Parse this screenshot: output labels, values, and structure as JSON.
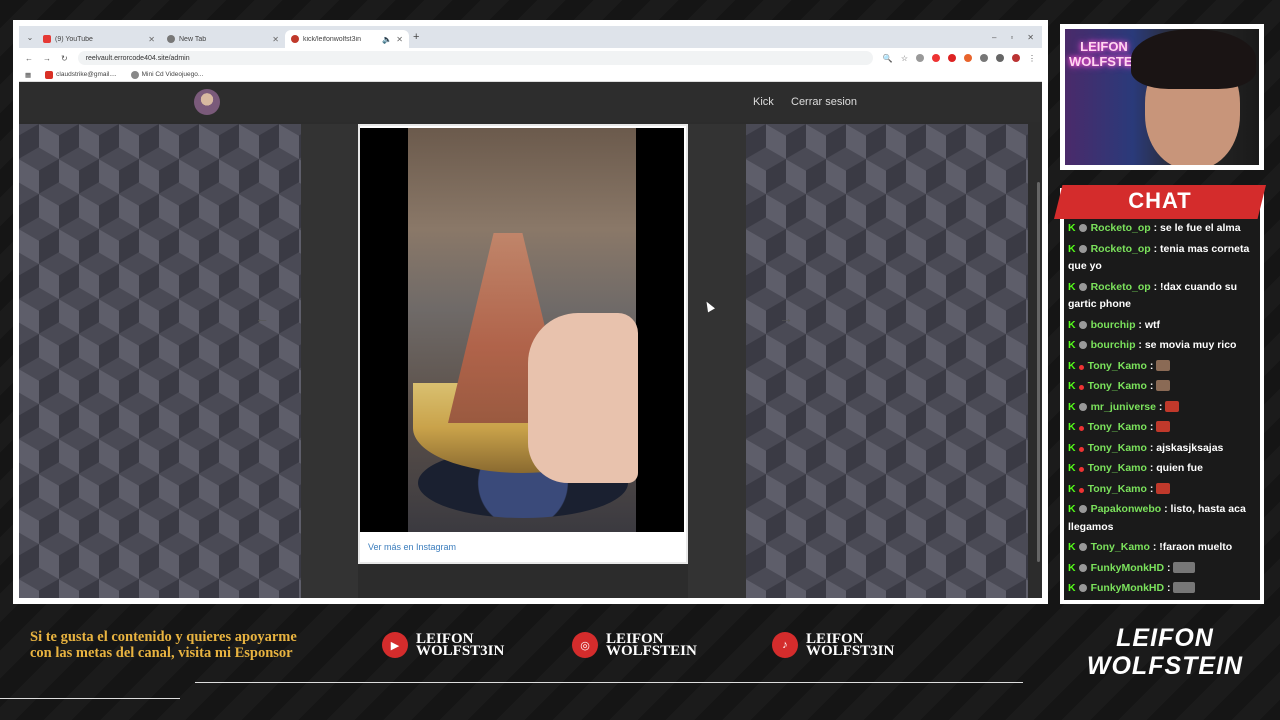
{
  "browser": {
    "tabs": [
      {
        "title": "(9) YouTube",
        "icon": "youtube-icon",
        "color": "#e53935",
        "active": false
      },
      {
        "title": "New Tab",
        "icon": "chrome-icon",
        "color": "#777777",
        "active": false
      },
      {
        "title": "kick/leifonwolfst3in",
        "icon": "kick-icon",
        "color": "#c0392b",
        "active": true
      }
    ],
    "url": "reelvault.errorcode404.site/admin",
    "bookmarks": [
      {
        "label": "claudstrike@gmail...."
      },
      {
        "label": "Mini Cd Videojuego..."
      }
    ]
  },
  "site": {
    "nav_kick": "Kick",
    "nav_logout": "Cerrar sesion",
    "instagram_link": "Ver más en Instagram"
  },
  "chat": {
    "title": "CHAT",
    "messages": [
      {
        "user": "Rocketo_op",
        "text": " : se le fue el alma"
      },
      {
        "user": "Rocketo_op",
        "text": " : tenia mas corneta que yo"
      },
      {
        "user": "Rocketo_op",
        "text": " : !dax cuando su gartic phone"
      },
      {
        "user": "bourchip",
        "text": " : wtf"
      },
      {
        "user": "bourchip",
        "text": " : se movia muy rico"
      },
      {
        "user": "Tony_Kamo",
        "text": " : ",
        "emote": "face"
      },
      {
        "user": "Tony_Kamo",
        "text": " : ",
        "emote": "face"
      },
      {
        "user": "mr_juniverse",
        "text": " : ",
        "emote": "red"
      },
      {
        "user": "Tony_Kamo",
        "text": " : ",
        "emote": "red"
      },
      {
        "user": "Tony_Kamo",
        "text": " : ajskasjksajas"
      },
      {
        "user": "Tony_Kamo",
        "text": " : quien fue"
      },
      {
        "user": "Tony_Kamo",
        "text": " : ",
        "emote": "red"
      },
      {
        "user": "Papakonwebo",
        "text": " : listo, hasta aca llegamos"
      },
      {
        "user": "Tony_Kamo",
        "text": " : !faraon muelto"
      },
      {
        "user": "FunkyMonkHD",
        "text": " : ",
        "emote": "gray"
      },
      {
        "user": "FunkyMonkHD",
        "text": " : ",
        "emote": "gray"
      }
    ]
  },
  "overlay": {
    "promo": "Si te gusta el contenido y quieres apoyarme con las metas del canal, visita mi Esponsor",
    "youtube": {
      "line1": "LEIFON",
      "line2": "WOLFST3IN"
    },
    "instagram": {
      "line1": "LEIFON",
      "line2": "WOLFSTEIN"
    },
    "tiktok": {
      "line1": "LEIFON",
      "line2": "WOLFST3IN"
    },
    "brand": {
      "line1": "LEIFON",
      "line2": "WOLFSTEIN"
    },
    "cam_neon": {
      "line1": "LEIFON",
      "line2": "WOLFSTEIN"
    }
  },
  "colors": {
    "accent": "#d42c2c",
    "gold": "#e8b340",
    "kick_green": "#53fc18"
  }
}
